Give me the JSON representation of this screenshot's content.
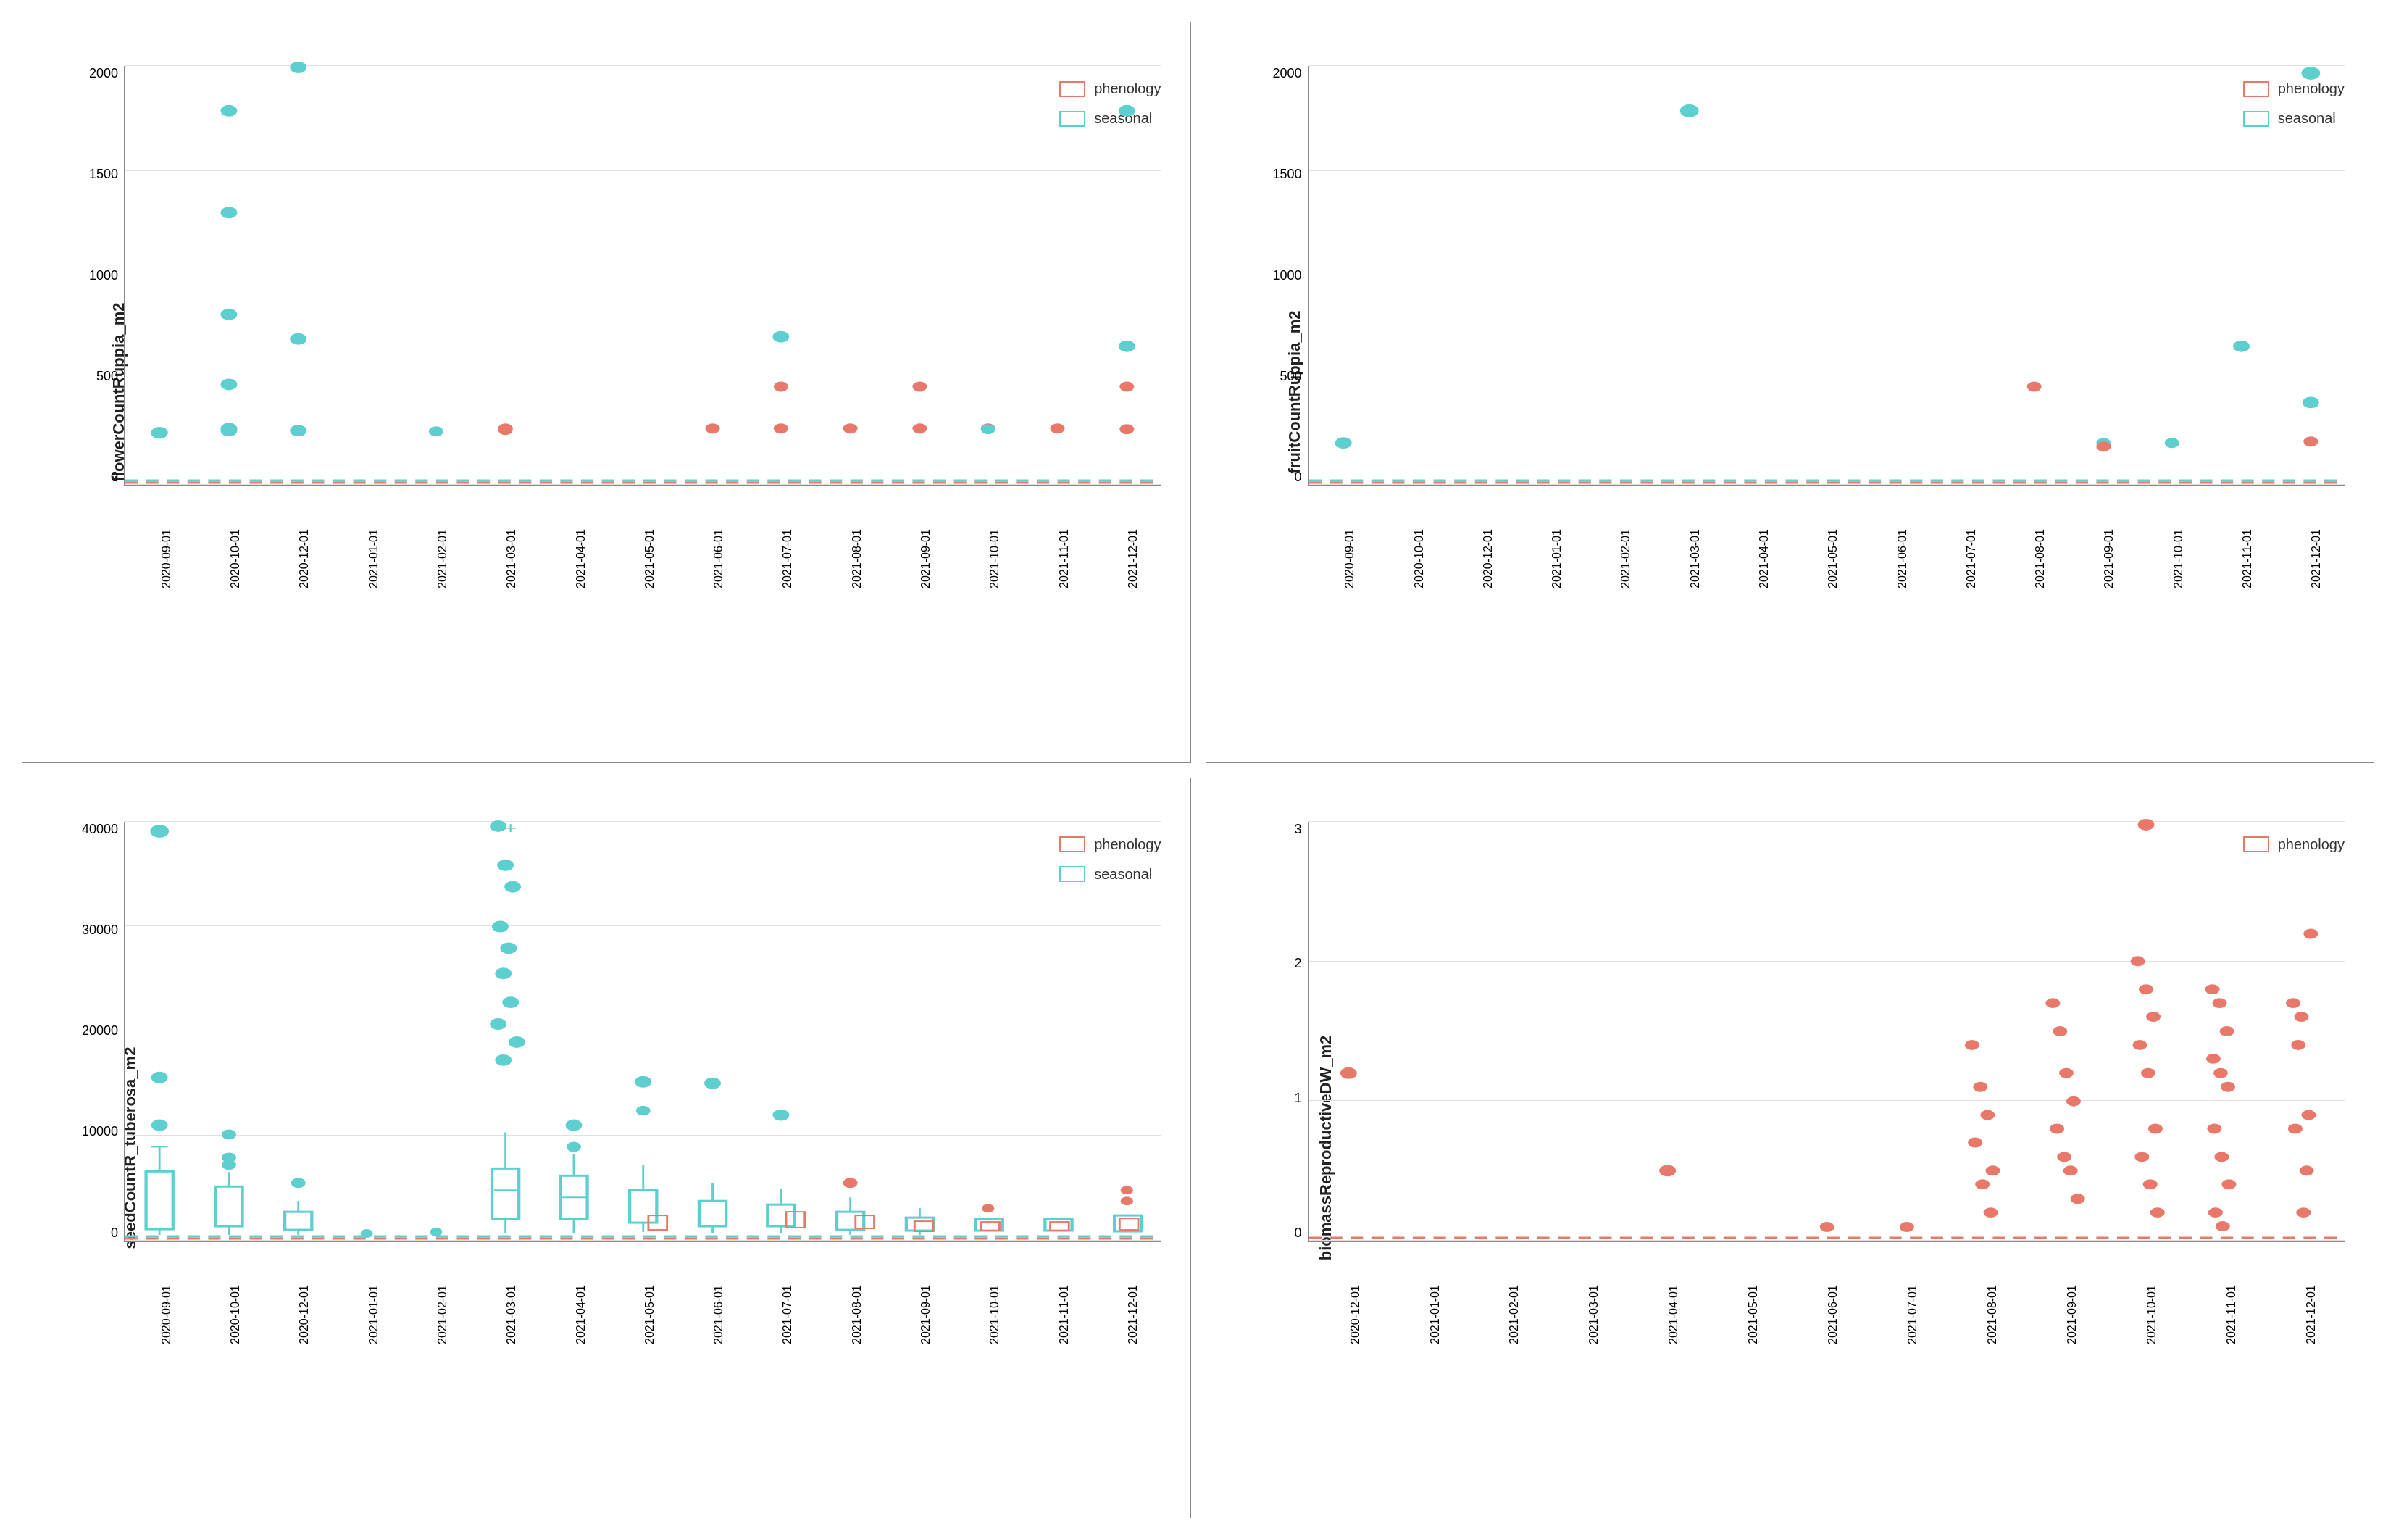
{
  "charts": [
    {
      "id": "chart-flower",
      "yLabel": "flowerCountRuppia_m2",
      "yTicks": [
        "0",
        "500",
        "1000",
        "1500",
        "2000"
      ],
      "xLabels": [
        "2020-09-01",
        "2020-10-01",
        "2020-12-01",
        "2021-01-01",
        "2021-02-01",
        "2021-03-01",
        "2021-04-01",
        "2021-05-01",
        "2021-06-01",
        "2021-07-01",
        "2021-08-01",
        "2021-09-01",
        "2021-10-01",
        "2021-11-01",
        "2021-12-01"
      ],
      "legend": [
        {
          "label": "phenology",
          "type": "phenology"
        },
        {
          "label": "seasonal",
          "type": "seasonal"
        }
      ],
      "hasSeasonalLegend": true
    },
    {
      "id": "chart-fruit",
      "yLabel": "fruitCountRuppia_m2",
      "yTicks": [
        "0",
        "500",
        "1000",
        "1500",
        "2000"
      ],
      "xLabels": [
        "2020-09-01",
        "2020-10-01",
        "2020-12-01",
        "2021-01-01",
        "2021-02-01",
        "2021-03-01",
        "2021-04-01",
        "2021-05-01",
        "2021-06-01",
        "2021-07-01",
        "2021-08-01",
        "2021-09-01",
        "2021-10-01",
        "2021-11-01",
        "2021-12-01"
      ],
      "legend": [
        {
          "label": "phenology",
          "type": "phenology"
        },
        {
          "label": "seasonal",
          "type": "seasonal"
        }
      ],
      "hasSeasonalLegend": true
    },
    {
      "id": "chart-seed",
      "yLabel": "seedCountR_tuberosa_m2",
      "yTicks": [
        "0",
        "10000",
        "20000",
        "30000",
        "40000"
      ],
      "xLabels": [
        "2020-09-01",
        "2020-10-01",
        "2020-12-01",
        "2021-01-01",
        "2021-02-01",
        "2021-03-01",
        "2021-04-01",
        "2021-05-01",
        "2021-06-01",
        "2021-07-01",
        "2021-08-01",
        "2021-09-01",
        "2021-10-01",
        "2021-11-01",
        "2021-12-01"
      ],
      "legend": [
        {
          "label": "phenology",
          "type": "phenology"
        },
        {
          "label": "seasonal",
          "type": "seasonal"
        }
      ],
      "hasSeasonalLegend": true
    },
    {
      "id": "chart-biomass",
      "yLabel": "biomassReproductiveDW_m2",
      "yTicks": [
        "0",
        "1",
        "2",
        "3"
      ],
      "xLabels": [
        "2020-12-01",
        "2021-01-01",
        "2021-02-01",
        "2021-03-01",
        "2021-04-01",
        "2021-05-01",
        "2021-06-01",
        "2021-07-01",
        "2021-08-01",
        "2021-09-01",
        "2021-10-01",
        "2021-11-01",
        "2021-12-01"
      ],
      "legend": [
        {
          "label": "phenology",
          "type": "phenology"
        }
      ],
      "hasSeasonalLegend": false
    }
  ],
  "colors": {
    "teal": "#5ecfcf",
    "salmon": "#e8796a",
    "border": "#888888",
    "gridline": "#e0e0e0",
    "text": "#333333"
  }
}
